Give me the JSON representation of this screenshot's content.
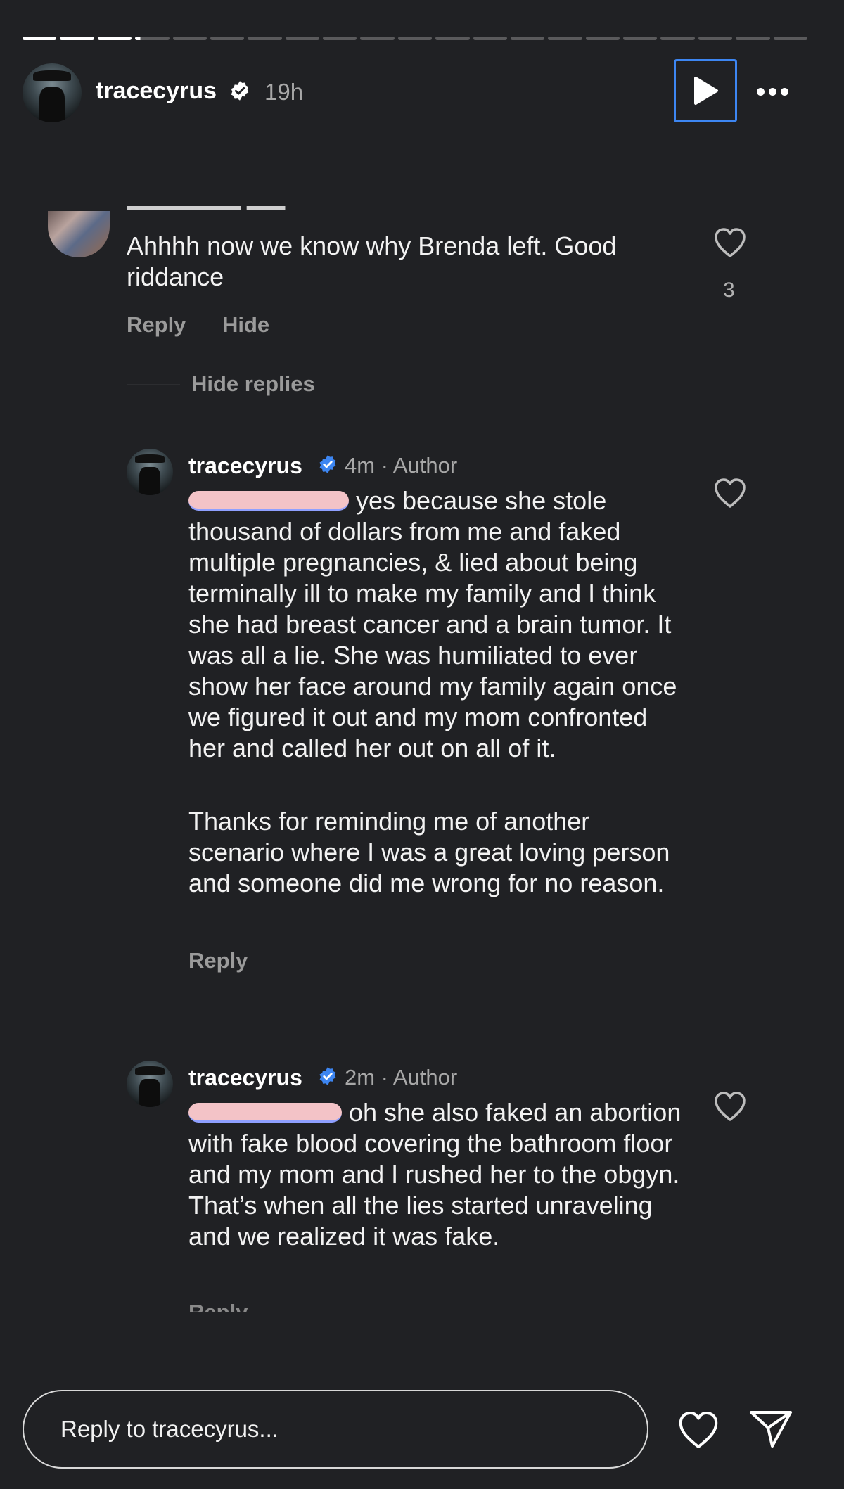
{
  "story": {
    "progress": {
      "segments": 21,
      "completed": 3,
      "current_fraction": 0.15
    },
    "username": "tracecyrus",
    "time": "19h"
  },
  "comment": {
    "text": "Ahhhh now we know why Brenda left. Good riddance",
    "likes": "3",
    "reply_label": "Reply",
    "hide_label": "Hide",
    "hide_replies_label": "Hide replies"
  },
  "replies": [
    {
      "username": "tracecyrus",
      "meta": "4m · Author",
      "text": "yes because she stole thousand of dollars from me and faked multiple pregnancies, & lied about being terminally ill  to make my family and I think she had breast cancer and a brain tumor. It was all a lie. She was humiliated to ever show her face around my family again once we figured it out and my mom confronted her and called her out on all of it.",
      "text2": "Thanks for reminding me of another scenario where I was a great loving person and someone did me wrong for no reason.",
      "reply_label": "Reply"
    },
    {
      "username": "tracecyrus",
      "meta": "2m · Author",
      "text": "oh she also faked an abortion with fake blood covering the bathroom floor and my mom and I rushed her to the obgyn. That’s when all the lies started unraveling and we realized it was fake.",
      "reply_label": "Reply"
    }
  ],
  "footer": {
    "reply_placeholder": "Reply to tracecyrus..."
  },
  "colors": {
    "background": "#202124",
    "verified": "#3d86f2",
    "redaction": "#f3c3c7"
  },
  "icons": [
    "play-icon",
    "more-icon",
    "verified-icon",
    "heart-icon",
    "send-icon"
  ]
}
